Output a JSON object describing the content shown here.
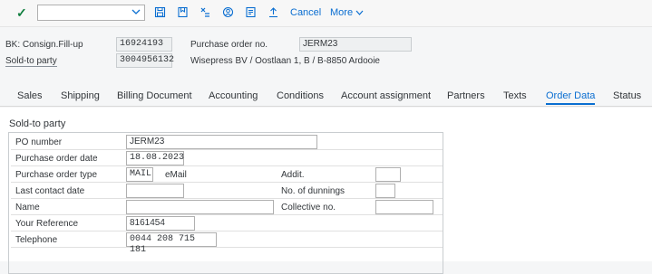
{
  "toolbar": {
    "cancel_label": "Cancel",
    "more_label": "More"
  },
  "header": {
    "bk_label": "BK: Consign.Fill-up",
    "bk_value": "16924193",
    "po_label": "Purchase order no.",
    "po_value": "JERM23",
    "sold_to_label": "Sold-to party",
    "sold_to_value": "3004956132",
    "sold_to_desc": "Wisepress BV / Oostlaan 1, B / B-8850 Ardooie"
  },
  "tabs": [
    {
      "label": "Sales"
    },
    {
      "label": "Shipping"
    },
    {
      "label": "Billing Document"
    },
    {
      "label": "Accounting"
    },
    {
      "label": "Conditions"
    },
    {
      "label": "Account assignment"
    },
    {
      "label": "Partners"
    },
    {
      "label": "Texts"
    },
    {
      "label": "Order Data"
    },
    {
      "label": "Status"
    }
  ],
  "section": {
    "title": "Sold-to party",
    "po_number_label": "PO number",
    "po_number_value": "JERM23",
    "po_date_label": "Purchase order date",
    "po_date_value": "18.08.2023",
    "po_type_label": "Purchase order type",
    "po_type_value": "MAIL",
    "po_type_desc": "eMail",
    "addit_label": "Addit.",
    "addit_value": "",
    "last_contact_label": "Last contact date",
    "last_contact_value": "",
    "dunnings_label": "No. of dunnings",
    "dunnings_value": "",
    "name_label": "Name",
    "name_value": "",
    "collective_label": "Collective no.",
    "collective_value": "",
    "your_ref_label": "Your Reference",
    "your_ref_value": "8161454",
    "telephone_label": "Telephone",
    "telephone_value": "0044 208 715 181"
  }
}
